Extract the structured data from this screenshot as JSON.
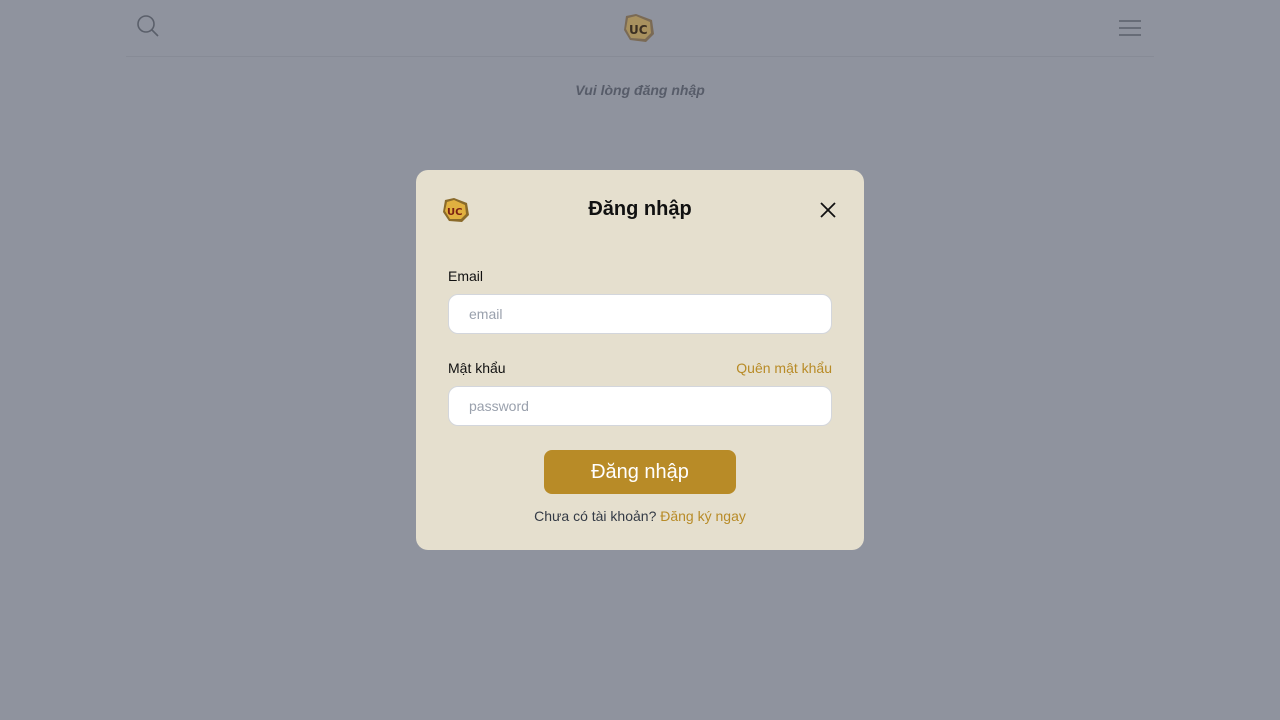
{
  "header": {
    "search_icon": "search-icon",
    "logo_icon": "brand-logo-icon",
    "menu_icon": "hamburger-menu-icon"
  },
  "notice": "Vui lòng đăng nhập",
  "modal": {
    "title": "Đăng nhập",
    "logo_icon": "brand-logo-icon",
    "close_icon": "close-icon",
    "email": {
      "label": "Email",
      "placeholder": "email",
      "value": ""
    },
    "password": {
      "label": "Mật khẩu",
      "placeholder": "password",
      "value": "",
      "forgot_label": "Quên mật khẩu"
    },
    "submit_label": "Đăng nhập",
    "signup_prompt": "Chưa có tài khoản?",
    "signup_link": "Đăng ký ngay"
  },
  "colors": {
    "overlay": "#8f939e",
    "modal_bg": "#e5dfce",
    "accent": "#b88b27"
  }
}
